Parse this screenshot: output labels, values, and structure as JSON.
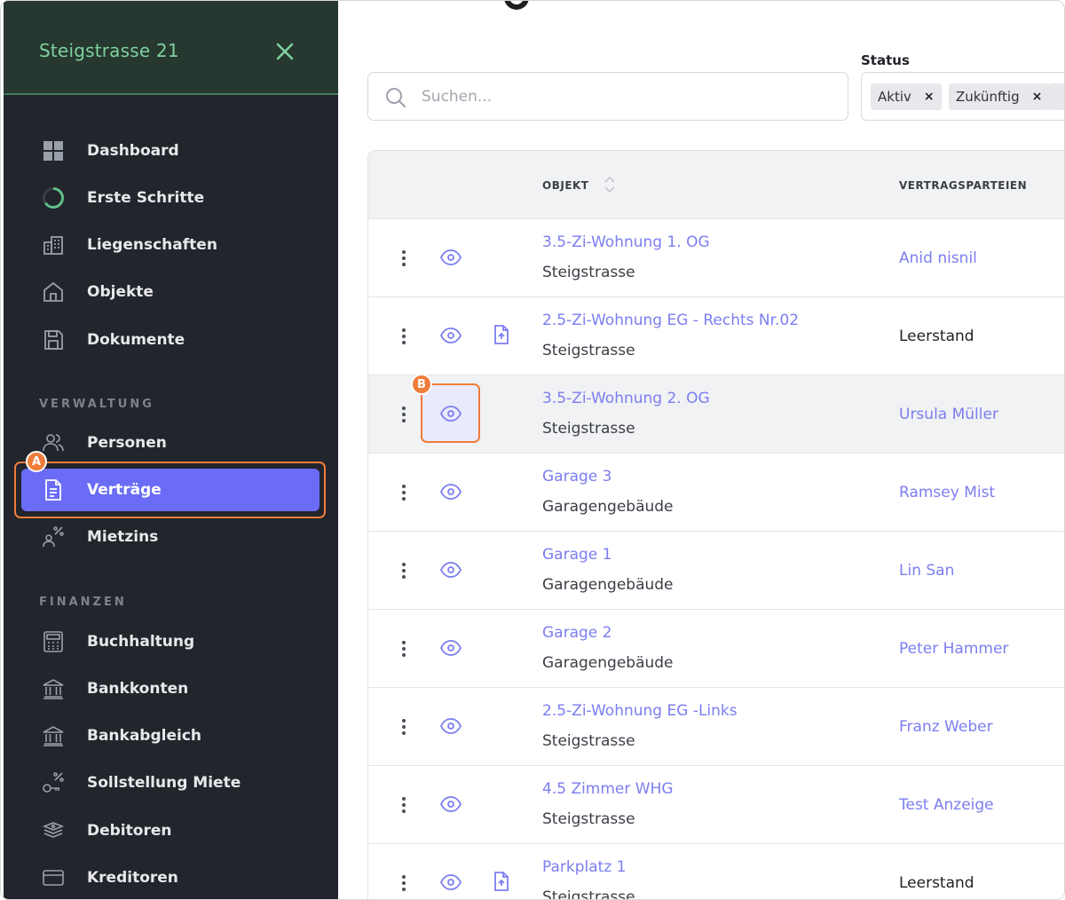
{
  "sidebar": {
    "title": "Steigstrasse 21",
    "close_icon": "close-icon",
    "main_items": [
      {
        "label": "Dashboard",
        "icon": "dashboard-grid-icon"
      },
      {
        "label": "Erste Schritte",
        "icon": "progress-ring-icon"
      },
      {
        "label": "Liegenschaften",
        "icon": "buildings-icon"
      },
      {
        "label": "Objekte",
        "icon": "home-icon"
      },
      {
        "label": "Dokumente",
        "icon": "save-document-icon"
      }
    ],
    "section_verwaltung": "VERWALTUNG",
    "verwaltung_items": [
      {
        "label": "Personen",
        "icon": "people-icon"
      },
      {
        "label": "Verträge",
        "icon": "contract-document-icon",
        "active": true
      },
      {
        "label": "Mietzins",
        "icon": "rent-percent-icon"
      }
    ],
    "section_finanzen": "FINANZEN",
    "finanzen_items": [
      {
        "label": "Buchhaltung",
        "icon": "calculator-icon"
      },
      {
        "label": "Bankkonten",
        "icon": "bank-icon"
      },
      {
        "label": "Bankabgleich",
        "icon": "bank-icon"
      },
      {
        "label": "Sollstellung Miete",
        "icon": "key-percent-icon"
      },
      {
        "label": "Debitoren",
        "icon": "money-stack-icon"
      },
      {
        "label": "Kreditoren",
        "icon": "credit-card-icon"
      }
    ]
  },
  "annotations": {
    "a": "A",
    "b": "B"
  },
  "filters": {
    "search_placeholder": "Suchen...",
    "status_label": "Status",
    "status_chips": [
      "Aktiv",
      "Zukünftig"
    ],
    "chip_remove": "×"
  },
  "table": {
    "columns": {
      "objekt": "OBJEKT",
      "parteien": "VERTRAGSPARTEIEN"
    },
    "rows": [
      {
        "objekt": "3.5-Zi-Wohnung 1. OG",
        "ort": "Steigstrasse",
        "partei": "Anid nisnil",
        "has_doc": false,
        "partei_link": true
      },
      {
        "objekt": "2.5-Zi-Wohnung EG - Rechts Nr.02",
        "ort": "Steigstrasse",
        "partei": "Leerstand",
        "has_doc": true,
        "partei_link": false
      },
      {
        "objekt": "3.5-Zi-Wohnung 2. OG",
        "ort": "Steigstrasse",
        "partei": "Ursula Müller",
        "has_doc": false,
        "partei_link": true
      },
      {
        "objekt": "Garage 3",
        "ort": "Garagengebäude",
        "partei": "Ramsey Mist",
        "has_doc": false,
        "partei_link": true
      },
      {
        "objekt": "Garage 1",
        "ort": "Garagengebäude",
        "partei": "Lin San",
        "has_doc": false,
        "partei_link": true
      },
      {
        "objekt": "Garage 2",
        "ort": "Garagengebäude",
        "partei": "Peter Hammer",
        "has_doc": false,
        "partei_link": true
      },
      {
        "objekt": "2.5-Zi-Wohnung EG -Links",
        "ort": "Steigstrasse",
        "partei": "Franz Weber",
        "has_doc": false,
        "partei_link": true
      },
      {
        "objekt": "4.5 Zimmer WHG",
        "ort": "Steigstrasse",
        "partei": "Test Anzeige",
        "has_doc": false,
        "partei_link": true
      },
      {
        "objekt": "Parkplatz 1",
        "ort": "Steigstrasse",
        "partei": "Leerstand",
        "has_doc": true,
        "partei_link": false
      }
    ]
  },
  "colors": {
    "accent": "#6a6cf6",
    "link": "#7b7ef0",
    "highlight": "#ef7c3a",
    "sidebar_bg": "#22252c",
    "header_green": "#7fd19d"
  }
}
